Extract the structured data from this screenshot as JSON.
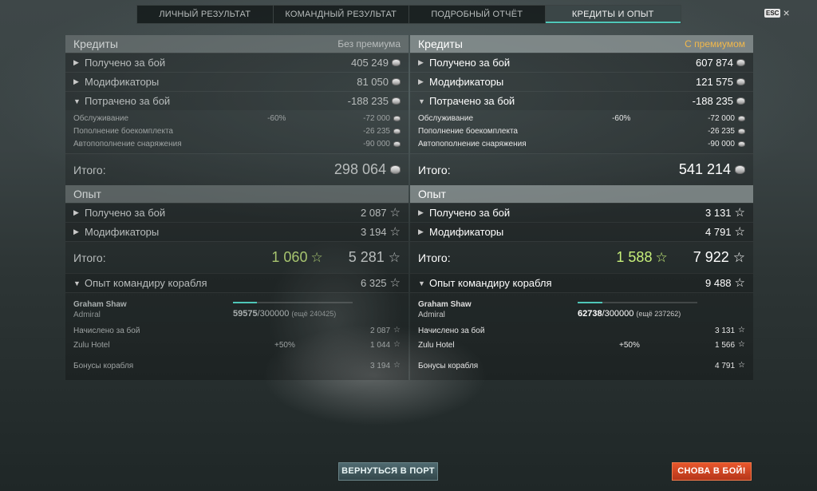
{
  "tabs": [
    {
      "label": "ЛИЧНЫЙ РЕЗУЛЬТАТ"
    },
    {
      "label": "КОМАНДНЫЙ РЕЗУЛЬТАТ"
    },
    {
      "label": "ПОДРОБНЫЙ ОТЧЁТ"
    },
    {
      "label": "КРЕДИТЫ И ОПЫТ"
    }
  ],
  "esc": {
    "key": "ESC",
    "close": "×"
  },
  "left": {
    "credits": {
      "title": "Кредиты",
      "tag": "Без премиума",
      "earned": {
        "label": "Получено за бой",
        "value": "405 249"
      },
      "modifiers": {
        "label": "Модификаторы",
        "value": "81 050"
      },
      "spent": {
        "label": "Потрачено за бой",
        "value": "-188 235"
      },
      "service": {
        "label": "Обслуживание",
        "pct": "-60%",
        "value": "-72 000"
      },
      "ammo": {
        "label": "Пополнение боекомплекта",
        "value": "-26 235"
      },
      "consumables": {
        "label": "Автопополнение снаряжения",
        "value": "-90 000"
      },
      "total": {
        "label": "Итого:",
        "value": "298 064"
      }
    },
    "xp": {
      "title": "Опыт",
      "earned": {
        "label": "Получено за бой",
        "value": "2 087"
      },
      "modifiers": {
        "label": "Модификаторы",
        "value": "3 194"
      },
      "total": {
        "label": "Итого:",
        "free": "1 060",
        "value": "5 281"
      },
      "commander": {
        "label": "Опыт командиру корабля",
        "value": "6 325"
      }
    },
    "cmd": {
      "name": "Graham Shaw",
      "rank": "Admiral",
      "progress": 0.1986,
      "xp_current": "59575",
      "xp_max": "/300000",
      "xp_remaining": "(ещё 240425)",
      "accrued": {
        "label": "Начислено за бой",
        "value": "2 087"
      },
      "hotel": {
        "label": "Zulu Hotel",
        "pct": "+50%",
        "value": "1 044"
      },
      "bonus": {
        "label": "Бонусы корабля",
        "value": "3 194"
      }
    }
  },
  "right": {
    "credits": {
      "title": "Кредиты",
      "tag": "С премиумом",
      "earned": {
        "label": "Получено за бой",
        "value": "607 874"
      },
      "modifiers": {
        "label": "Модификаторы",
        "value": "121 575"
      },
      "spent": {
        "label": "Потрачено за бой",
        "value": "-188 235"
      },
      "service": {
        "label": "Обслуживание",
        "pct": "-60%",
        "value": "-72 000"
      },
      "ammo": {
        "label": "Пополнение боекомплекта",
        "value": "-26 235"
      },
      "consumables": {
        "label": "Автопополнение снаряжения",
        "value": "-90 000"
      },
      "total": {
        "label": "Итого:",
        "value": "541 214"
      }
    },
    "xp": {
      "title": "Опыт",
      "earned": {
        "label": "Получено за бой",
        "value": "3 131"
      },
      "modifiers": {
        "label": "Модификаторы",
        "value": "4 791"
      },
      "total": {
        "label": "Итого:",
        "free": "1 588",
        "value": "7 922"
      },
      "commander": {
        "label": "Опыт командиру корабля",
        "value": "9 488"
      }
    },
    "cmd": {
      "name": "Graham Shaw",
      "rank": "Admiral",
      "progress": 0.2091,
      "xp_current": "62738",
      "xp_max": "/300000",
      "xp_remaining": "(ещё 237262)",
      "accrued": {
        "label": "Начислено за бой",
        "value": "3 131"
      },
      "hotel": {
        "label": "Zulu Hotel",
        "pct": "+50%",
        "value": "1 566"
      },
      "bonus": {
        "label": "Бонусы корабля",
        "value": "4 791"
      }
    }
  },
  "buttons": {
    "port": "ВЕРНУТЬСЯ В ПОРТ",
    "battle": "СНОВА В БОЙ!"
  },
  "icons": {
    "credit": "credit-coin-icon",
    "xp": "star-icon",
    "expand": "triangle-right-icon",
    "collapse": "triangle-down-icon"
  },
  "colors": {
    "accent": "#4fc7b8",
    "premium": "#f2b84b",
    "battle_button": "#d9472a",
    "free_xp_green": "#c7f07a"
  }
}
